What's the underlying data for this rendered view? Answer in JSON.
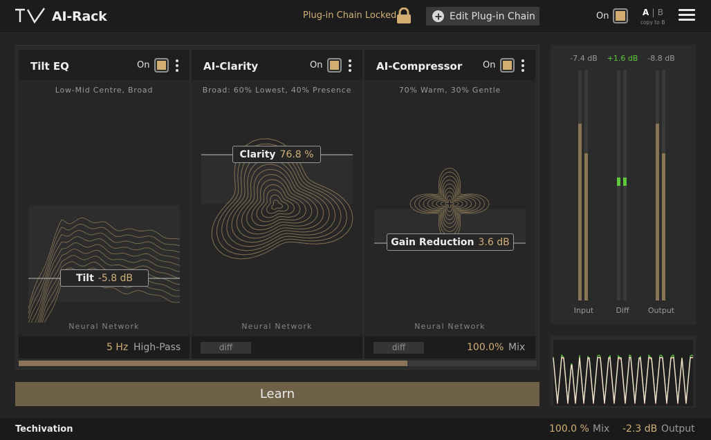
{
  "header": {
    "app_title": "AI-Rack",
    "lock_status": "Plug-in Chain Locked",
    "edit_button_label": "Edit Plug-in Chain",
    "on_label": "On",
    "ab_a": "A",
    "ab_sep": "|",
    "ab_b": "B",
    "copy_label": "copy to B",
    "icons": [
      "tv-logo-icon",
      "lock-icon",
      "plus-circle-icon",
      "hamburger-menu-icon"
    ]
  },
  "modules": [
    {
      "title": "Tilt EQ",
      "on_label": "On",
      "subtitle": "Low-Mid Centre, Broad",
      "param_name": "Tilt",
      "param_value": "-5.8 dB",
      "network_label": "Neural Network",
      "footer_value": "5 Hz",
      "footer_label": "High-Pass"
    },
    {
      "title": "AI-Clarity",
      "on_label": "On",
      "subtitle": "Broad: 60% Lowest, 40% Presence",
      "param_name": "Clarity",
      "param_value": "76.8 %",
      "network_label": "Neural Network",
      "diff_label": "diff"
    },
    {
      "title": "AI-Compressor",
      "on_label": "On",
      "subtitle": "70% Warm, 30% Gentle",
      "param_name": "Gain Reduction",
      "param_value": "3.6 dB",
      "network_label": "Neural Network",
      "diff_label": "diff",
      "footer_value": "100.0%",
      "footer_label": "Mix"
    }
  ],
  "learn_progress": 0.75,
  "learn_label": "Learn",
  "meters": {
    "input": {
      "reading": "-7.4 dB",
      "label": "Input",
      "level": 0.77
    },
    "diff": {
      "reading": "+1.6 dB",
      "label": "Diff"
    },
    "output": {
      "reading": "-8.8 dB",
      "label": "Output",
      "level": 0.77
    },
    "diff_color": "#5cc93a"
  },
  "footer": {
    "brand": "Techivation",
    "mix_value": "100.0 %",
    "mix_label": "Mix",
    "output_value": "-2.3 dB",
    "output_label": "Output"
  },
  "colors": {
    "accent": "#d0b078",
    "background": "#242424",
    "panel": "#2b2b2b"
  }
}
